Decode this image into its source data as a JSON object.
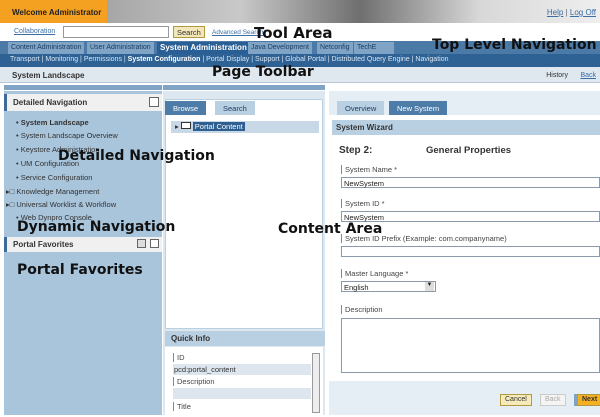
{
  "header": {
    "welcome": "Welcome Administrator",
    "help": "Help",
    "separator": "|",
    "logoff": "Log Off"
  },
  "toolarea": {
    "collaboration": "Collaboration",
    "search_value": "",
    "search_button": "Search",
    "advanced_search": "Advanced Search"
  },
  "topnav": {
    "tabs": [
      "Content Administration",
      "User Administration",
      "System Administration",
      "Java Development",
      "Netconfig",
      "TechE"
    ],
    "active": "System Administration"
  },
  "subnav": {
    "items": [
      "Transport",
      "Monitoring",
      "Permissions",
      "System Configuration",
      "Portal Display",
      "Support",
      "Global Portal",
      "Distributed Query Engine",
      "Navigation"
    ],
    "active": "System Configuration"
  },
  "pagetoolbar": {
    "title": "System Landscape",
    "history": "History",
    "back": "Back"
  },
  "detailed_nav": {
    "title": "Detailed Navigation",
    "items": [
      "System Landscape",
      "System Landscape Overview",
      "Keystore Administration",
      "UM Configuration",
      "Service Configuration"
    ],
    "folders": [
      "Knowledge Management",
      "Universal Worklist & Workflow"
    ],
    "last": "Web Dynpro Console"
  },
  "portal_favorites": {
    "title": "Portal Favorites"
  },
  "browser": {
    "tabs": [
      "Browse",
      "Search"
    ],
    "tree_item": "Portal Content"
  },
  "quick_info": {
    "title": "Quick Info",
    "id_label": "ID",
    "id_value": "pcd:portal_content",
    "desc_label": "Description",
    "title_label": "Title"
  },
  "content": {
    "tabs": [
      "Overview",
      "New System"
    ],
    "wizard_title": "System Wizard",
    "step": "Step 2:",
    "step_title": "General Properties",
    "system_name_label": "System Name *",
    "system_name": "NewSystem",
    "system_id_label": "System ID *",
    "system_id": "NewSystem",
    "prefix_label": "System ID Prefix (Example: com.companyname)",
    "prefix": "",
    "language_label": "Master Language *",
    "language": "English",
    "description_label": "Description",
    "description": "",
    "cancel": "Cancel",
    "back": "Back",
    "next": "Next"
  },
  "annotations": {
    "tool_area": "Tool Area",
    "top_nav": "Top Level Navigation",
    "page_toolbar": "Page Toolbar",
    "detailed_nav": "Detailed Navigation",
    "dynamic_nav": "Dynamic Navigation",
    "content_area": "Content Area",
    "portal_favorites": "Portal Favorites"
  },
  "colors": {
    "accent": "#f4a020",
    "nav": "#2e6295",
    "panel": "#a9c5dc"
  }
}
